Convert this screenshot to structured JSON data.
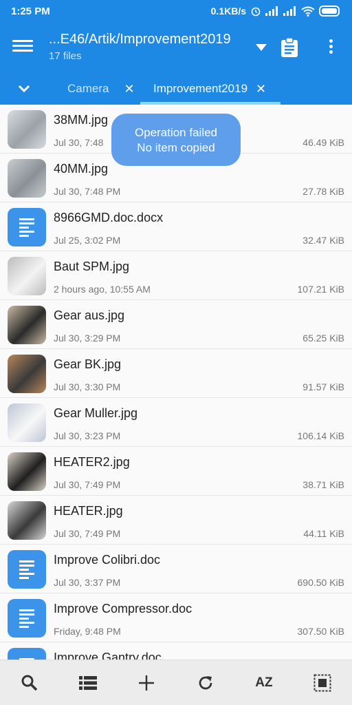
{
  "status_bar": {
    "time": "1:25 PM",
    "speed": "0.1KB/s"
  },
  "header": {
    "path": "...E46/Artik/Improvement2019",
    "file_count": "17 files"
  },
  "tabs": [
    {
      "label": "Camera",
      "active": false
    },
    {
      "label": "Improvement2019",
      "active": true
    }
  ],
  "toast": {
    "line1": "Operation failed",
    "line2": "No item copied"
  },
  "files": [
    {
      "name": "38MM.jpg",
      "date": "Jul 30, 7:48",
      "size": "46.49 KiB",
      "kind": "image"
    },
    {
      "name": "40MM.jpg",
      "date": "Jul 30, 7:48 PM",
      "size": "27.78 KiB",
      "kind": "image"
    },
    {
      "name": "8966GMD.doc.docx",
      "date": "Jul 25, 3:02 PM",
      "size": "32.47 KiB",
      "kind": "doc"
    },
    {
      "name": "Baut SPM.jpg",
      "date": "2 hours ago, 10:55 AM",
      "size": "107.21 KiB",
      "kind": "image"
    },
    {
      "name": "Gear aus.jpg",
      "date": "Jul 30, 3:29 PM",
      "size": "65.25 KiB",
      "kind": "image"
    },
    {
      "name": "Gear BK.jpg",
      "date": "Jul 30, 3:30 PM",
      "size": "91.57 KiB",
      "kind": "image"
    },
    {
      "name": "Gear Muller.jpg",
      "date": "Jul 30, 3:23 PM",
      "size": "106.14 KiB",
      "kind": "image"
    },
    {
      "name": "HEATER2.jpg",
      "date": "Jul 30, 7:49 PM",
      "size": "38.71 KiB",
      "kind": "image"
    },
    {
      "name": "HEATER.jpg",
      "date": "Jul 30, 7:49 PM",
      "size": "44.11 KiB",
      "kind": "image"
    },
    {
      "name": "Improve Colibri.doc",
      "date": "Jul 30, 3:37 PM",
      "size": "690.50 KiB",
      "kind": "doc"
    },
    {
      "name": "Improve Compressor.doc",
      "date": "Friday, 9:48 PM",
      "size": "307.50 KiB",
      "kind": "doc"
    },
    {
      "name": "Improve Gantry.doc",
      "date": "",
      "size": "",
      "kind": "doc"
    }
  ],
  "bottom_bar": {
    "sort_label": "AZ",
    "icons": [
      "search-icon",
      "list-view-icon",
      "add-icon",
      "refresh-icon",
      "sort-icon",
      "select-all-icon"
    ]
  },
  "colors": {
    "primary": "#1e88e5",
    "doc_icon": "#3b93ea",
    "toast": "#5e9eea",
    "tab_indicator": "#80d8ff"
  }
}
